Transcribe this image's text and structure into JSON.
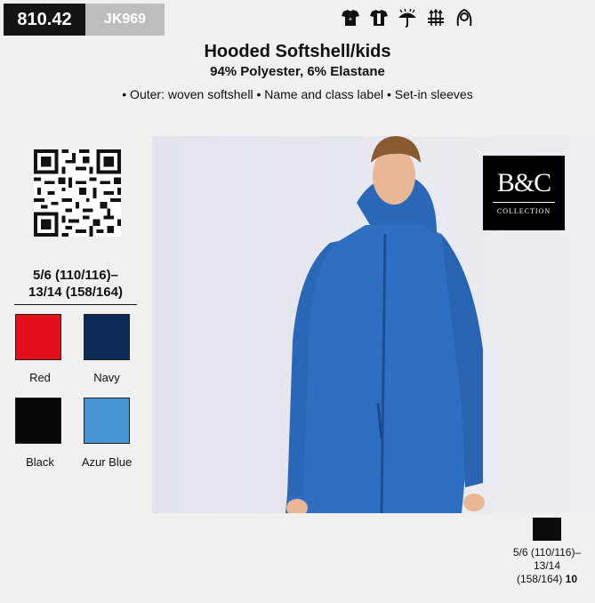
{
  "header": {
    "article_number": "810.42",
    "article_code": "JK969",
    "care_icons": [
      "kids-tshirt-icon",
      "tshirt-icon",
      "umbrella-icon",
      "breathable-icon",
      "hood-icon"
    ]
  },
  "product": {
    "title": "Hooded Softshell/kids",
    "material": "94% Polyester, 6% Elastane",
    "features": "• Outer: woven softshell • Name and class label • Set-in sleeves"
  },
  "sizes": {
    "line1": "5/6 (110/116)–",
    "line2": "13/14 (158/164)"
  },
  "colors": [
    {
      "name": "Red",
      "hex": "#e3101b"
    },
    {
      "name": "Navy",
      "hex": "#0b2a57"
    },
    {
      "name": "Black",
      "hex": "#070707"
    },
    {
      "name": "Azur Blue",
      "hex": "#4694d6"
    }
  ],
  "brand": {
    "logo_mark": "B&C",
    "logo_sub": "COLLECTION"
  },
  "packaging": {
    "line1": "5/6 (110/116)–",
    "line2": "13/14",
    "line3": "(158/164)",
    "quantity": "10"
  }
}
